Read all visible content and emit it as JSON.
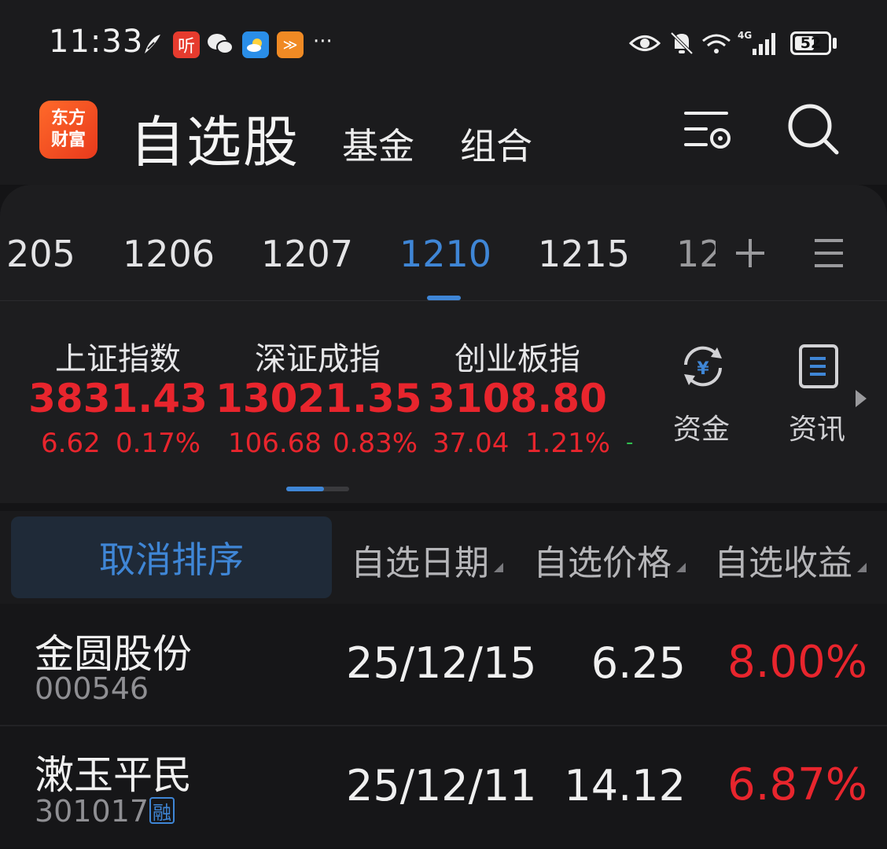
{
  "status_bar": {
    "time": "11:33",
    "apps": [
      "听",
      "≫"
    ],
    "more": "···",
    "battery": "52",
    "signal_label": "4G"
  },
  "header": {
    "logo_line1": "东方",
    "logo_line2": "财富",
    "tabs": [
      "自选股",
      "基金",
      "组合"
    ]
  },
  "date_tabs": {
    "items": [
      "205",
      "1206",
      "1207",
      "1210",
      "1215",
      "12"
    ],
    "active": "1210"
  },
  "indices": [
    {
      "name": "上证指数",
      "value": "3831.43",
      "change": "6.62",
      "pct": "0.17%"
    },
    {
      "name": "深证成指",
      "value": "13021.35",
      "change": "106.68",
      "pct": "0.83%"
    },
    {
      "name": "创业板指",
      "value": "3108.80",
      "change": "37.04",
      "pct": "1.21%"
    }
  ],
  "index_extra": "-",
  "tools": [
    {
      "label": "资金",
      "icon": "money-flow-icon"
    },
    {
      "label": "资讯",
      "icon": "news-icon"
    }
  ],
  "sort_header": {
    "cancel_sort": "取消排序",
    "columns": [
      "自选日期",
      "自选价格",
      "自选收益"
    ]
  },
  "stocks": [
    {
      "name": "金圆股份",
      "code": "000546",
      "date": "25/12/15",
      "price": "6.25",
      "gain": "8.00%",
      "badge": ""
    },
    {
      "name": "潄玉平民",
      "code": "301017",
      "date": "25/12/11",
      "price": "14.12",
      "gain": "6.87%",
      "badge": "融"
    }
  ],
  "colors": {
    "accent": "#3f86d6",
    "up": "#e8252d",
    "down": "#2fbf4f",
    "brand": "#f05a22"
  }
}
